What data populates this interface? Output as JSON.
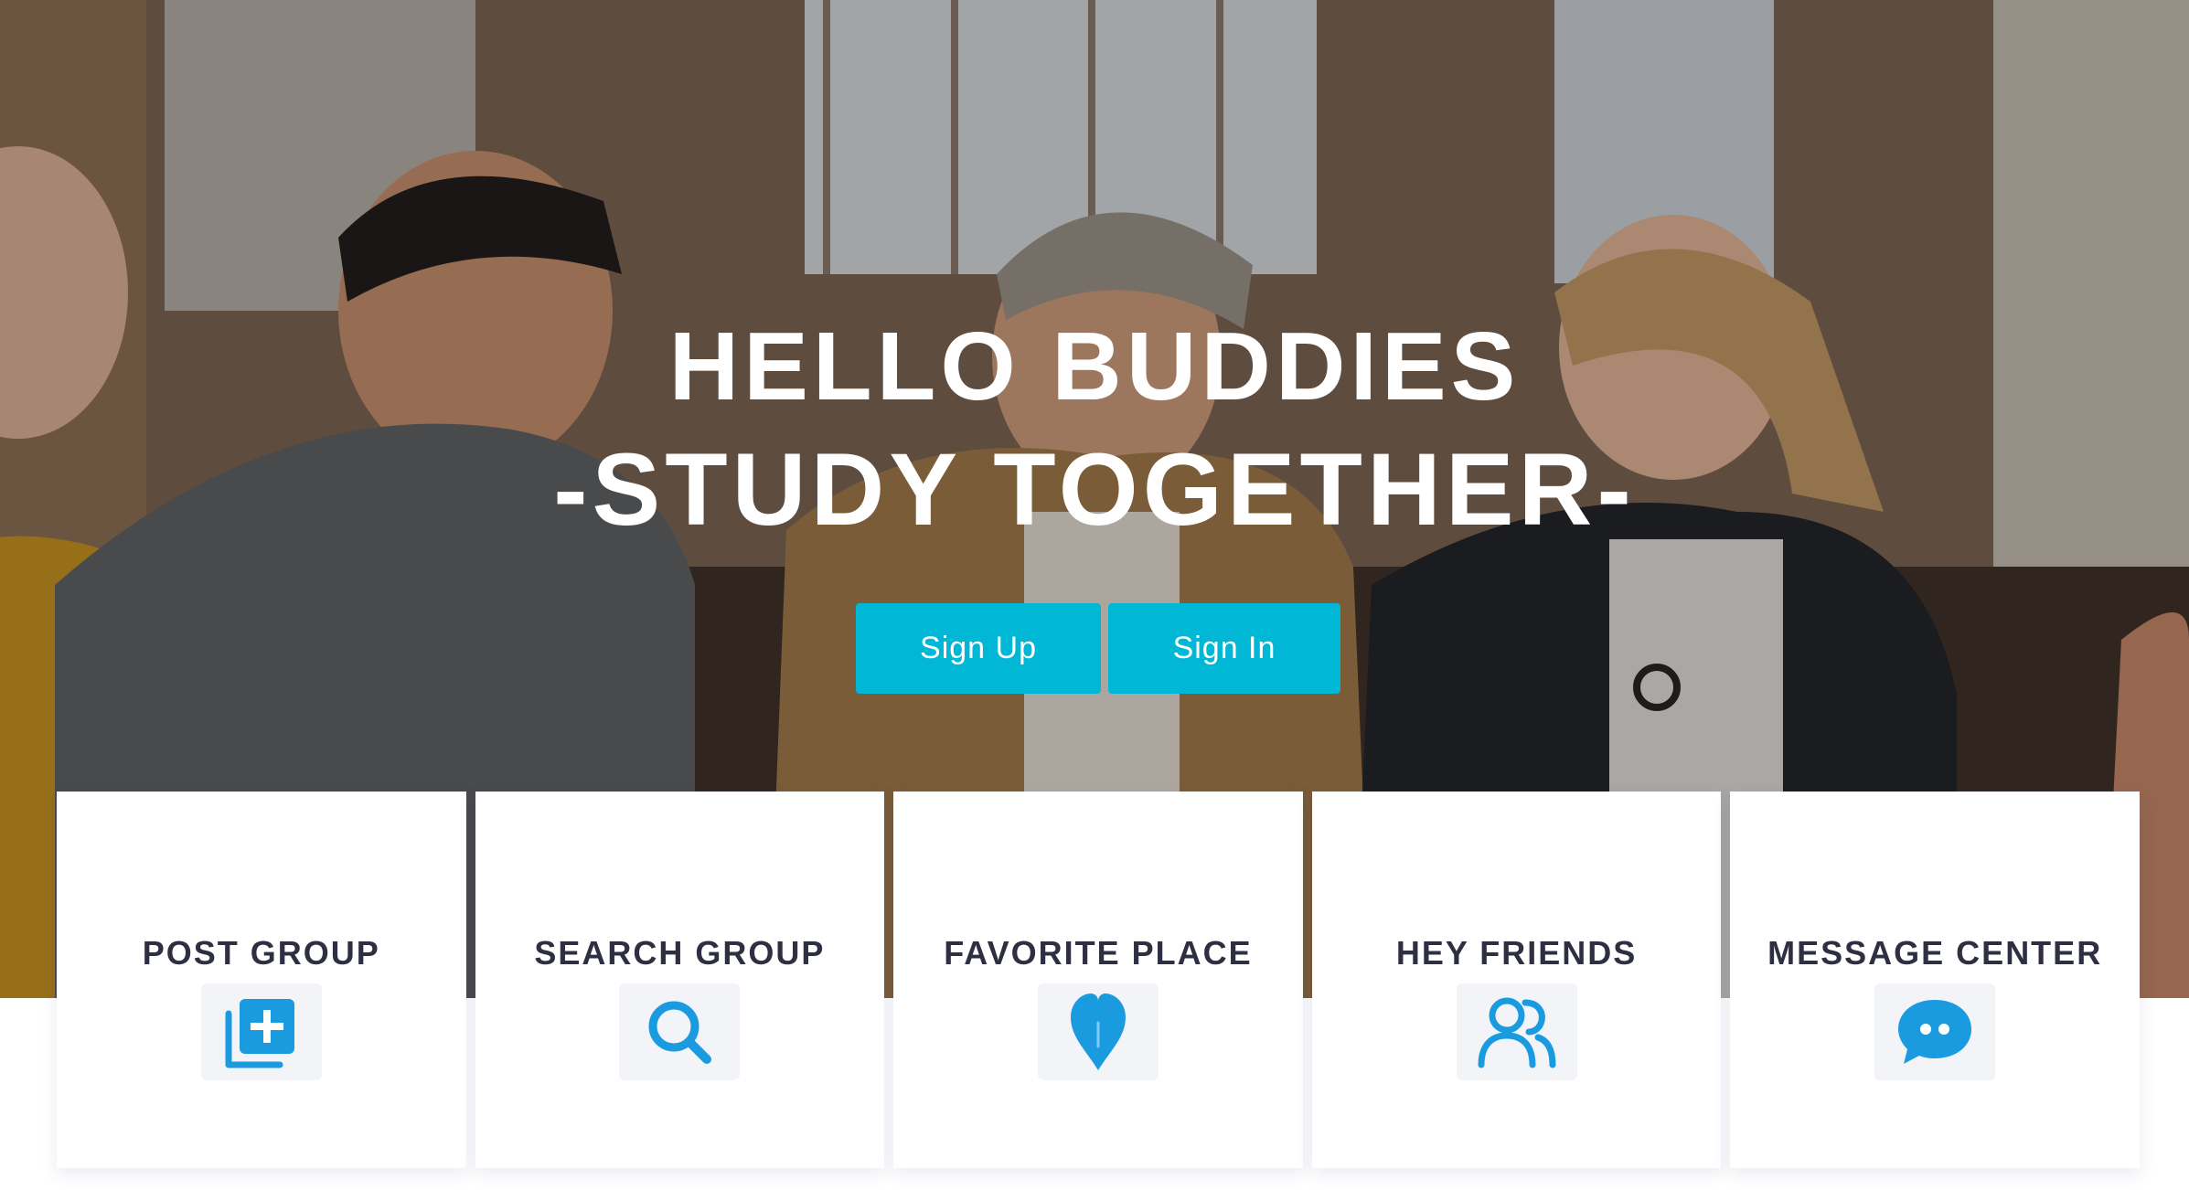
{
  "hero": {
    "title_line1": "HELLO BUDDIES",
    "title_line2": "-STUDY TOGETHER-",
    "signup_label": "Sign Up",
    "signin_label": "Sign In"
  },
  "features": [
    {
      "label": "POST GROUP",
      "icon": "post-group-icon"
    },
    {
      "label": "SEARCH GROUP",
      "icon": "search-icon"
    },
    {
      "label": "FAVORITE PLACE",
      "icon": "heart-pin-icon"
    },
    {
      "label": "HEY FRIENDS",
      "icon": "friends-icon"
    },
    {
      "label": "MESSAGE CENTER",
      "icon": "chat-bubble-icon"
    }
  ],
  "colors": {
    "accent": "#00b7d6",
    "icon": "#1a9be0",
    "label_text": "#2e3042",
    "icon_tile": "#f2f4f8"
  }
}
